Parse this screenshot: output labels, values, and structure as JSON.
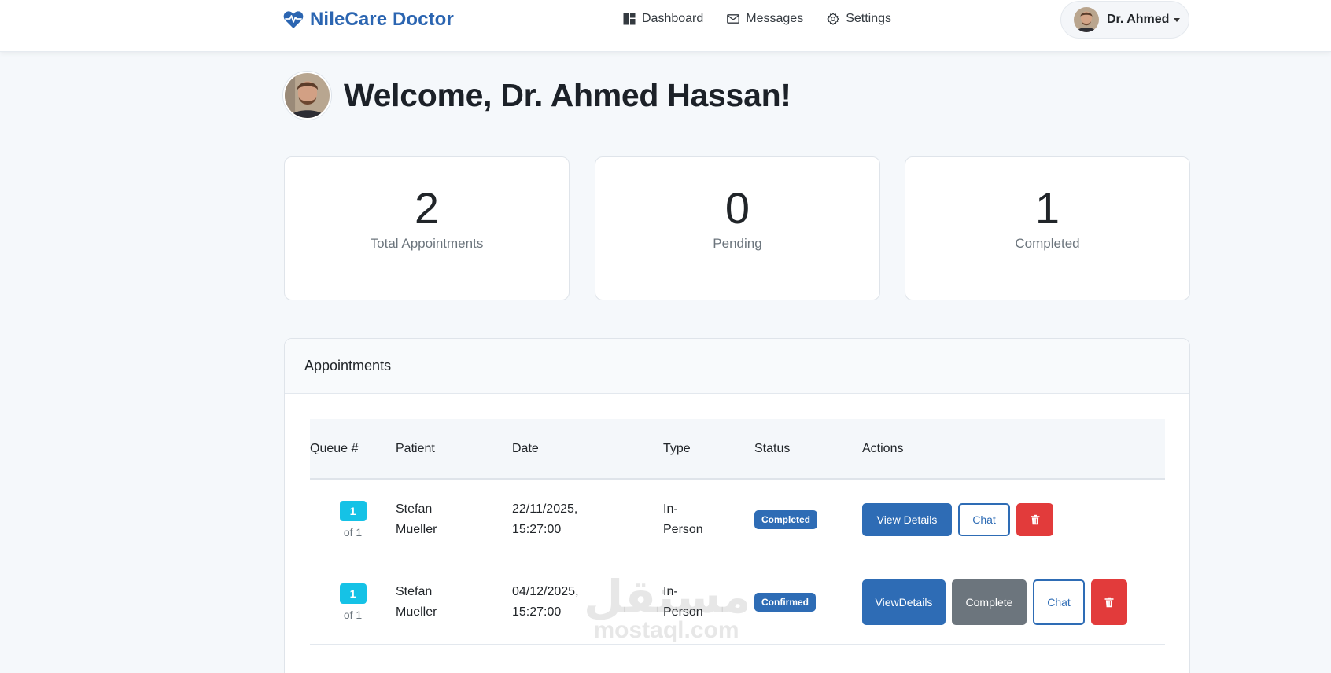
{
  "brand": {
    "name": "NileCare Doctor",
    "icon": "heart-pulse-icon",
    "color": "#2b65b1"
  },
  "nav": [
    {
      "label": "Dashboard",
      "icon": "dashboard-icon"
    },
    {
      "label": "Messages",
      "icon": "envelope-icon"
    },
    {
      "label": "Settings",
      "icon": "gear-icon"
    }
  ],
  "user": {
    "name": "Dr. Ahmed"
  },
  "welcome": {
    "title": "Welcome, Dr. Ahmed Hassan!"
  },
  "stats": [
    {
      "value": "2",
      "label": "Total Appointments"
    },
    {
      "value": "0",
      "label": "Pending"
    },
    {
      "value": "1",
      "label": "Completed"
    }
  ],
  "appointments": {
    "title": "Appointments",
    "columns": [
      "Queue #",
      "Patient",
      "Date",
      "Type",
      "Status",
      "Actions"
    ],
    "rows": [
      {
        "queue": "1",
        "queue_of": "of 1",
        "patient_first": "Stefan",
        "patient_last": "Mueller",
        "date": "22/11/2025,",
        "time": "15:27:00",
        "type_1": "In-",
        "type_2": "Person",
        "status": "Completed",
        "actions": {
          "view": "View Details",
          "chat": "Chat"
        }
      },
      {
        "queue": "1",
        "queue_of": "of 1",
        "patient_first": "Stefan",
        "patient_last": "Mueller",
        "date": "04/12/2025,",
        "time": "15:27:00",
        "type_1": "In-",
        "type_2": "Person",
        "status": "Confirmed",
        "actions": {
          "view_1": "View",
          "view_2": "Details",
          "complete": "Complete",
          "chat": "Chat"
        }
      }
    ]
  },
  "watermark": {
    "arabic": "مستقل",
    "latin": "mostaql.com"
  },
  "colors": {
    "primary": "#2e6cb5",
    "info": "#15c2e6",
    "danger": "#e23b3b",
    "secondary": "#6c757d",
    "background": "#f5f8fb"
  }
}
